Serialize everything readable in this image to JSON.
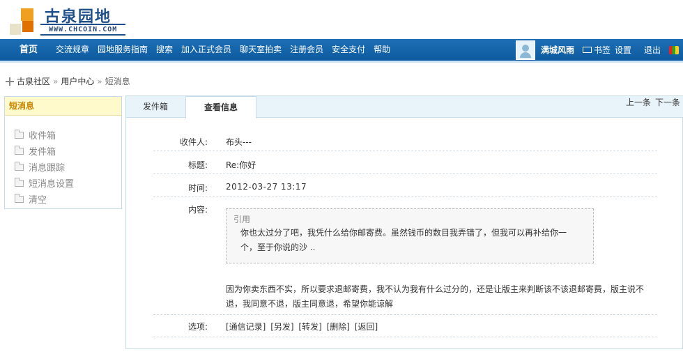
{
  "logo": {
    "title": "古泉园地",
    "url": "WWW.CHCOIN.COM"
  },
  "nav": {
    "home": "首页",
    "items": [
      "交流规章",
      "园地服务指南",
      "搜索",
      "加入正式会员",
      "聊天室拍卖",
      "注册会员",
      "安全支付",
      "帮助"
    ],
    "username": "满城风雨",
    "bookmarks": "书签",
    "settings": "设置",
    "logout": "退出"
  },
  "breadcrumb": {
    "items": [
      "古泉社区",
      "用户中心"
    ],
    "current": "短消息",
    "separator": "»"
  },
  "sidebar": {
    "title": "短消息",
    "items": [
      "收件箱",
      "发件箱",
      "消息跟踪",
      "短消息设置",
      "清空"
    ]
  },
  "tabs": {
    "sent": "发件箱",
    "view": "查看信息"
  },
  "pager": {
    "prev": "上一条",
    "next": "下一条"
  },
  "message": {
    "recipient_label": "收件人:",
    "recipient": "布头---",
    "subject_label": "标题:",
    "subject": "Re:你好",
    "time_label": "时间:",
    "time": "2012-03-27 13:17",
    "content_label": "内容:",
    "quote_label": "引用",
    "quote_text": "你也太过分了吧，我凭什么给你邮寄费。虽然钱币的数目我弄错了，但我可以再补给你一个，至于你说的沙 ..",
    "reply_text": "因为你卖东西不实，所以要求退邮寄费，我不认为我有什么过分的，还是让版主来判断该不该退邮寄费，版主说不退，我同意不退，版主同意退，希望你能谅解",
    "options_label": "选项:",
    "options": [
      "[通信记录]",
      "[另发]",
      "[转发]",
      "[删除]",
      "[返回]"
    ]
  }
}
